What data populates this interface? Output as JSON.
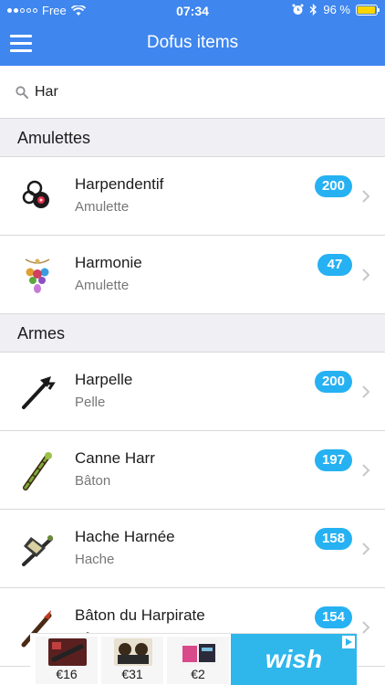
{
  "status_bar": {
    "carrier": "Free",
    "time": "07:34",
    "battery_text": "96 %",
    "battery_level": 0.96,
    "colors": {
      "battery_fill": "#ffd400"
    }
  },
  "nav": {
    "title": "Dofus items",
    "menu_icon": "hamburger-menu-icon",
    "color": "#3f86ee"
  },
  "search": {
    "value": "Har",
    "icon": "search-icon"
  },
  "sections": [
    {
      "title": "Amulettes",
      "items": [
        {
          "name": "Harpendentif",
          "type": "Amulette",
          "level": "200",
          "icon": "amulet-icon"
        },
        {
          "name": "Harmonie",
          "type": "Amulette",
          "level": "47",
          "icon": "amulet-icon"
        }
      ]
    },
    {
      "title": "Armes",
      "items": [
        {
          "name": "Harpelle",
          "type": "Pelle",
          "level": "200",
          "icon": "shovel-icon"
        },
        {
          "name": "Canne Harr",
          "type": "Bâton",
          "level": "197",
          "icon": "staff-icon"
        },
        {
          "name": "Hache Harnée",
          "type": "Hache",
          "level": "158",
          "icon": "axe-icon"
        },
        {
          "name": "Bâton du Harpirate",
          "type": "Bâton",
          "level": "154",
          "icon": "staff-icon"
        }
      ]
    }
  ],
  "ad": {
    "products": [
      {
        "price": "€16"
      },
      {
        "price": "€31"
      },
      {
        "price": "€2"
      }
    ],
    "brand": "wish",
    "colors": {
      "brand_bg": "#2fb7ec",
      "badge": "#26b1f2"
    }
  }
}
